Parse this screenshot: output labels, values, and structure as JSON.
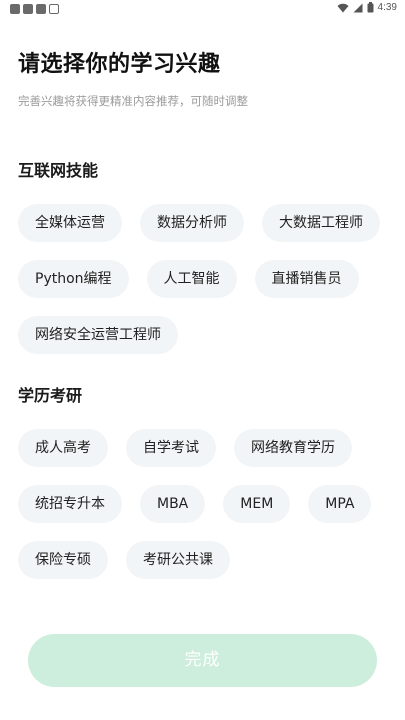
{
  "status_bar": {
    "time": "4:39",
    "icons": [
      "notification-icon",
      "notification-icon",
      "notification-icon",
      "text-notification-icon",
      "wifi-icon",
      "signal-icon",
      "battery-icon"
    ]
  },
  "header": {
    "title": "请选择你的学习兴趣",
    "subtitle": "完善兴趣将获得更精准内容推荐，可随时调整"
  },
  "sections": [
    {
      "title": "互联网技能",
      "tags": [
        "全媒体运营",
        "数据分析师",
        "大数据工程师",
        "Python编程",
        "人工智能",
        "直播销售员",
        "网络安全运营工程师"
      ]
    },
    {
      "title": "学历考研",
      "tags": [
        "成人高考",
        "自学考试",
        "网络教育学历",
        "统招专升本",
        "MBA",
        "MEM",
        "MPA",
        "保险专硕",
        "考研公共课"
      ]
    }
  ],
  "footer": {
    "done_label": "完成"
  },
  "colors": {
    "chip_bg": "#f2f5f7",
    "button_bg": "#cdeedc",
    "subtitle": "#9a9a9a"
  }
}
